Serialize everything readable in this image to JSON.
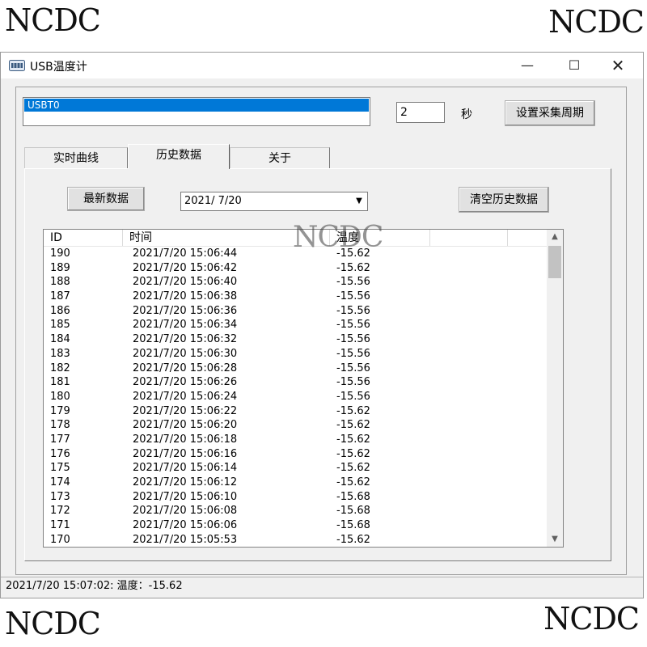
{
  "watermarks": [
    "NCDC",
    "NCDC",
    "NCDC",
    "NCDC",
    "NCDC"
  ],
  "window": {
    "title": "USB温度计",
    "controls": {
      "minimize": "—",
      "maximize": "☐",
      "close": "✕"
    }
  },
  "device_list": {
    "items": [
      "USBT0"
    ]
  },
  "sampling": {
    "period_value": "2",
    "unit_label": "秒",
    "set_button": "设置采集周期"
  },
  "tabs": [
    {
      "label": "实时曲线"
    },
    {
      "label": "历史数据"
    },
    {
      "label": "关于"
    }
  ],
  "history": {
    "latest_button": "最新数据",
    "date_value": "2021/ 7/20",
    "clear_button": "清空历史数据",
    "columns": [
      "ID",
      "时间",
      "温度",
      ""
    ],
    "rows": [
      {
        "id": "190",
        "time": "2021/7/20 15:06:44",
        "temp": "-15.62"
      },
      {
        "id": "189",
        "time": "2021/7/20 15:06:42",
        "temp": "-15.62"
      },
      {
        "id": "188",
        "time": "2021/7/20 15:06:40",
        "temp": "-15.56"
      },
      {
        "id": "187",
        "time": "2021/7/20 15:06:38",
        "temp": "-15.56"
      },
      {
        "id": "186",
        "time": "2021/7/20 15:06:36",
        "temp": "-15.56"
      },
      {
        "id": "185",
        "time": "2021/7/20 15:06:34",
        "temp": "-15.56"
      },
      {
        "id": "184",
        "time": "2021/7/20 15:06:32",
        "temp": "-15.56"
      },
      {
        "id": "183",
        "time": "2021/7/20 15:06:30",
        "temp": "-15.56"
      },
      {
        "id": "182",
        "time": "2021/7/20 15:06:28",
        "temp": "-15.56"
      },
      {
        "id": "181",
        "time": "2021/7/20 15:06:26",
        "temp": "-15.56"
      },
      {
        "id": "180",
        "time": "2021/7/20 15:06:24",
        "temp": "-15.56"
      },
      {
        "id": "179",
        "time": "2021/7/20 15:06:22",
        "temp": "-15.62"
      },
      {
        "id": "178",
        "time": "2021/7/20 15:06:20",
        "temp": "-15.62"
      },
      {
        "id": "177",
        "time": "2021/7/20 15:06:18",
        "temp": "-15.62"
      },
      {
        "id": "176",
        "time": "2021/7/20 15:06:16",
        "temp": "-15.62"
      },
      {
        "id": "175",
        "time": "2021/7/20 15:06:14",
        "temp": "-15.62"
      },
      {
        "id": "174",
        "time": "2021/7/20 15:06:12",
        "temp": "-15.62"
      },
      {
        "id": "173",
        "time": "2021/7/20 15:06:10",
        "temp": "-15.68"
      },
      {
        "id": "172",
        "time": "2021/7/20 15:06:08",
        "temp": "-15.68"
      },
      {
        "id": "171",
        "time": "2021/7/20 15:06:06",
        "temp": "-15.68"
      },
      {
        "id": "170",
        "time": "2021/7/20 15:05:53",
        "temp": "-15.62"
      }
    ]
  },
  "status_bar": {
    "text": "2021/7/20 15:07:02: 温度：-15.62"
  }
}
